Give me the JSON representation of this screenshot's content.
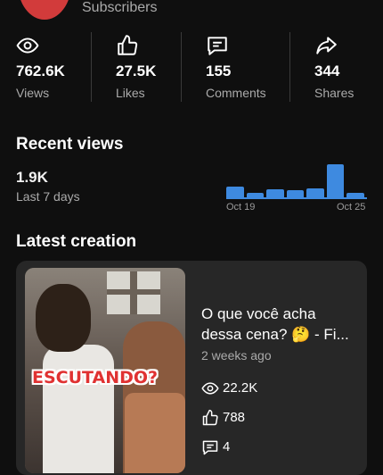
{
  "channel": {
    "subscribers_label": "Subscribers"
  },
  "stats": [
    {
      "icon": "eye-icon",
      "value": "762.6K",
      "label": "Views"
    },
    {
      "icon": "thumbs-up-icon",
      "value": "27.5K",
      "label": "Likes"
    },
    {
      "icon": "comment-icon",
      "value": "155",
      "label": "Comments"
    },
    {
      "icon": "share-icon",
      "value": "344",
      "label": "Shares"
    }
  ],
  "recent_views": {
    "title": "Recent views",
    "value": "1.9K",
    "period": "Last 7 days",
    "chart_data": {
      "type": "bar",
      "categories": [
        "Oct 19",
        "Oct 20",
        "Oct 21",
        "Oct 22",
        "Oct 23",
        "Oct 24",
        "Oct 25"
      ],
      "tick_labels": [
        "Oct 19",
        "Oct 25"
      ],
      "values": [
        0.35,
        0.17,
        0.26,
        0.24,
        0.3,
        1.0,
        0.17
      ],
      "color": "#3e8ae0"
    }
  },
  "latest_creation": {
    "title": "Latest creation",
    "video": {
      "thumbnail_caption": "ESCUTANDO?",
      "title": "O que você acha dessa cena? 🤔 - Fi...",
      "age": "2 weeks ago",
      "views": "22.2K",
      "likes": "788",
      "comments": "4"
    }
  }
}
